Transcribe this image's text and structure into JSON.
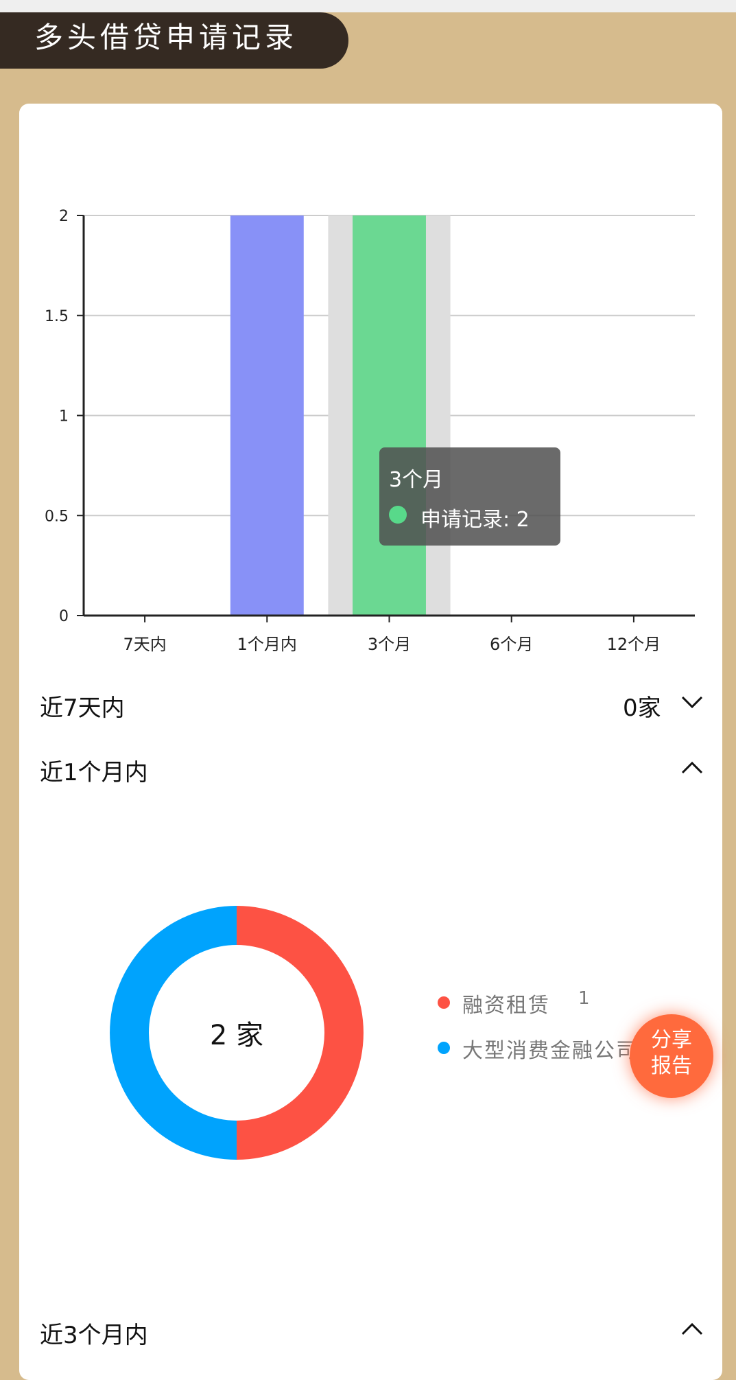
{
  "header": {
    "title": "多头借贷申请记录"
  },
  "chart_data": [
    {
      "type": "bar",
      "categories": [
        "7天内",
        "1个月内",
        "3个月",
        "6个月",
        "12个月"
      ],
      "series": [
        {
          "name": "申请记录",
          "values": [
            0,
            2,
            2,
            0,
            0
          ]
        }
      ],
      "y_ticks": [
        "0",
        "0.5",
        "1",
        "1.5",
        "2"
      ],
      "ylim": [
        0,
        2
      ],
      "grid": true,
      "colors": [
        "#8891f7",
        "#6bd892"
      ],
      "highlight_category": "3个月",
      "tooltip": {
        "title": "3个月",
        "label": "申请记录",
        "value": "2"
      }
    },
    {
      "type": "pie",
      "center_label": "2 家",
      "slices": [
        {
          "name": "融资租赁",
          "value": 1,
          "color": "#fd5244"
        },
        {
          "name": "大型消费金融公司",
          "value": 1,
          "color": "#00a3fd"
        }
      ]
    }
  ],
  "sections": [
    {
      "label": "近7天内",
      "value": "0家",
      "expanded": false
    },
    {
      "label": "近1个月内",
      "value": "",
      "expanded": true
    },
    {
      "label": "近3个月内",
      "value": "",
      "expanded": true
    }
  ],
  "legend_counts": [
    "1",
    ""
  ],
  "share_button": {
    "line1": "分享",
    "line2": "报告"
  }
}
